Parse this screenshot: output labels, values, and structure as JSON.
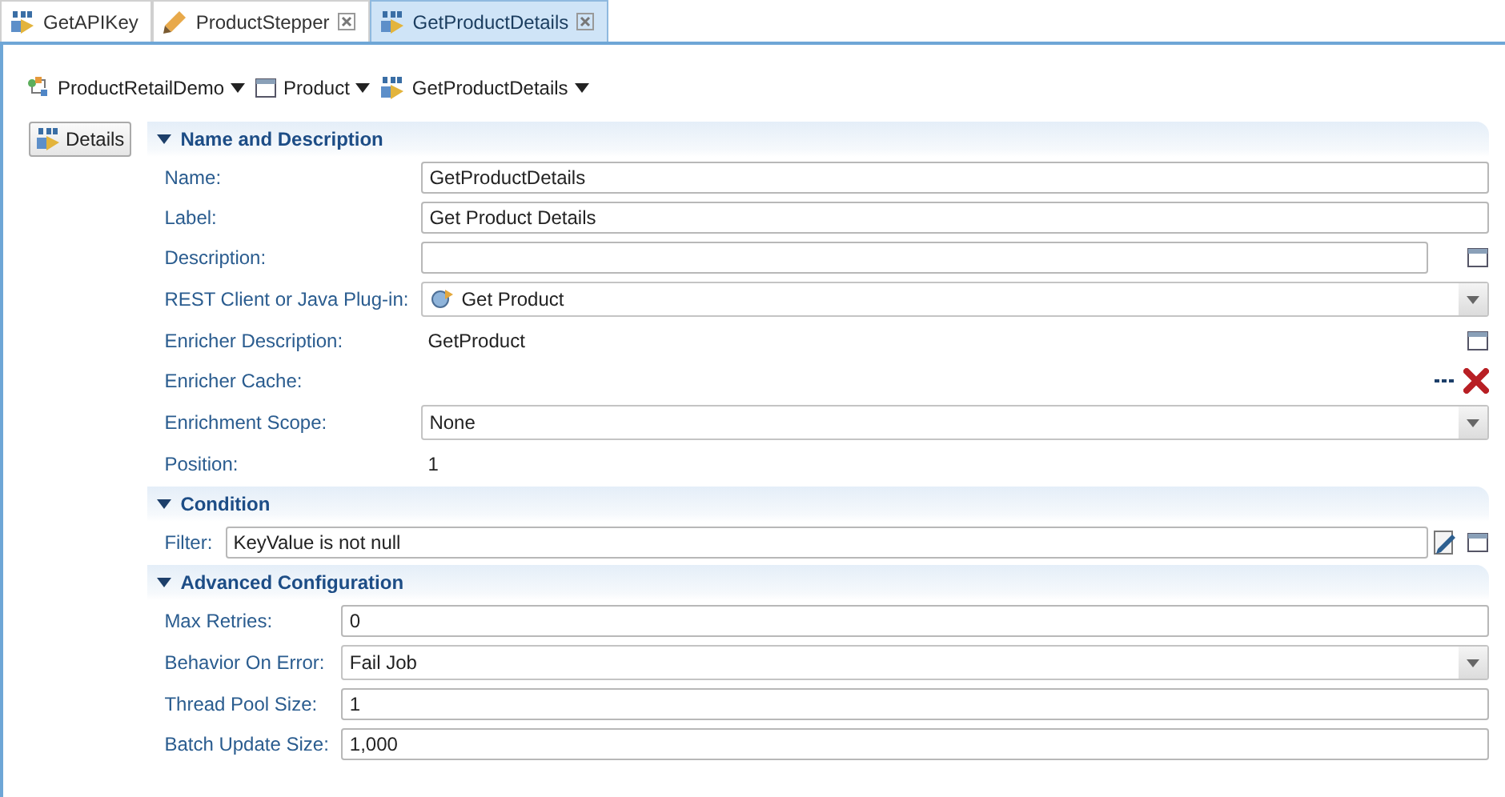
{
  "tabs": [
    {
      "label": "GetAPIKey",
      "kind": "enricher",
      "closable": false,
      "selected": false
    },
    {
      "label": "ProductStepper",
      "kind": "stepper",
      "closable": true,
      "selected": false
    },
    {
      "label": "GetProductDetails",
      "kind": "enricher",
      "closable": true,
      "selected": true
    }
  ],
  "breadcrumb": [
    {
      "label": "ProductRetailDemo",
      "kind": "project"
    },
    {
      "label": "Product",
      "kind": "window"
    },
    {
      "label": "GetProductDetails",
      "kind": "enricher"
    }
  ],
  "side_button": {
    "label": "Details"
  },
  "sections": [
    {
      "title": "Name and Description",
      "expanded": true,
      "rows": [
        {
          "label": "Name:",
          "kind": "text",
          "value": "GetProductDetails"
        },
        {
          "label": "Label:",
          "kind": "text",
          "value": "Get Product Details"
        },
        {
          "label": "Description:",
          "kind": "text_popout",
          "value": ""
        },
        {
          "label": "REST Client or Java Plug-in:",
          "kind": "combo_plugin",
          "value": "Get Product"
        },
        {
          "label": "Enricher Description:",
          "kind": "static_popout",
          "value": "GetProduct"
        },
        {
          "label": "Enricher Cache:",
          "kind": "cache",
          "value": ""
        },
        {
          "label": "Enrichment Scope:",
          "kind": "combo",
          "value": "None"
        },
        {
          "label": "Position:",
          "kind": "static",
          "value": "1"
        }
      ]
    },
    {
      "title": "Condition",
      "expanded": true,
      "rows": [
        {
          "label": "Filter:",
          "kind": "filter",
          "value": "KeyValue is not null"
        }
      ]
    },
    {
      "title": "Advanced Configuration",
      "expanded": true,
      "rows": [
        {
          "label": "Max Retries:",
          "kind": "text",
          "value": "0"
        },
        {
          "label": "Behavior On Error:",
          "kind": "combo",
          "value": "Fail Job"
        },
        {
          "label": "Thread Pool Size:",
          "kind": "text",
          "value": "1"
        },
        {
          "label": "Batch Update Size:",
          "kind": "text",
          "value": "1,000"
        }
      ]
    }
  ]
}
